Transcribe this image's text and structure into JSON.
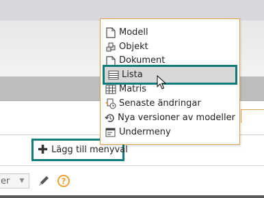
{
  "menu": {
    "items": [
      {
        "label": "Modell",
        "icon": "page-icon"
      },
      {
        "label": "Objekt",
        "icon": "cubes-icon"
      },
      {
        "label": "Dokument",
        "icon": "page-icon"
      },
      {
        "label": "Lista",
        "icon": "list-icon"
      },
      {
        "label": "Matris",
        "icon": "grid-icon"
      },
      {
        "label": "Senaste ändringar",
        "icon": "recent-changes-icon"
      },
      {
        "label": "Nya versioner av modeller",
        "icon": "history-icon"
      },
      {
        "label": "Undermeny",
        "icon": "submenu-icon"
      }
    ],
    "selected": "Lista"
  },
  "add_menu": {
    "label": "Lägg till menyval",
    "icon": "plus-icon"
  },
  "bottom_bar": {
    "select_value": "er"
  },
  "colors": {
    "highlight_border": "#117a7a",
    "dropdown_border": "#e5a04e",
    "band": "#bdbdbd"
  }
}
